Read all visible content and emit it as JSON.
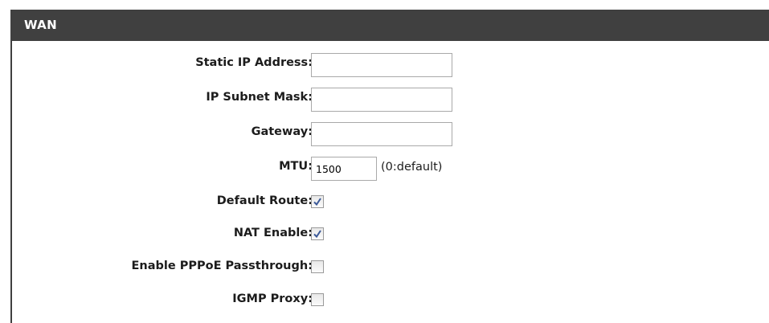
{
  "header": {
    "title": "WAN"
  },
  "fields": {
    "static_ip": {
      "label": "Static IP Address:",
      "value": ""
    },
    "subnet_mask": {
      "label": "IP Subnet Mask:",
      "value": ""
    },
    "gateway": {
      "label": "Gateway:",
      "value": ""
    },
    "mtu": {
      "label": "MTU:",
      "value": "1500",
      "hint": "(0:default)"
    }
  },
  "options": {
    "default_route": {
      "label": "Default Route:",
      "checked": true
    },
    "nat_enable": {
      "label": "NAT Enable:",
      "checked": true
    },
    "pppoe_passthrough": {
      "label": "Enable PPPoE Passthrough:",
      "checked": false
    },
    "igmp_proxy": {
      "label": "IGMP Proxy:",
      "checked": false
    }
  },
  "colors": {
    "header_bg": "#404040",
    "header_text": "#ffffff",
    "checkmark": "#3b5998"
  }
}
